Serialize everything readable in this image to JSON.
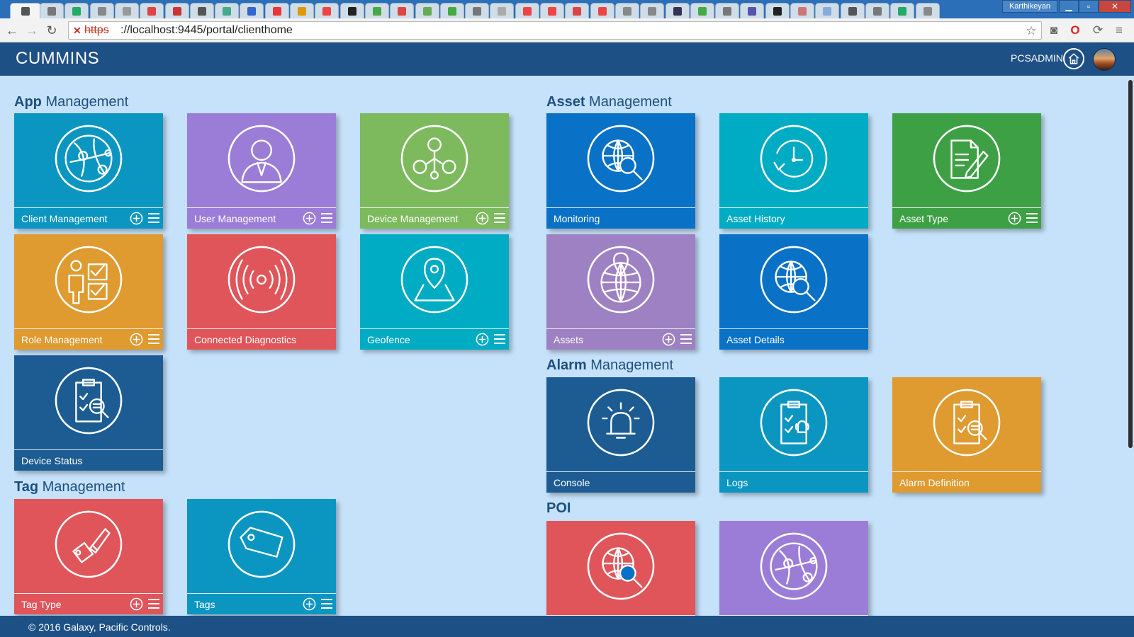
{
  "browser": {
    "profile_name": "Karthikeyan",
    "url_scheme": "https",
    "url_rest": "://localhost:9445/portal/clienthome",
    "tab_count": 37
  },
  "header": {
    "brand": "CUMMINS",
    "username": "PCSADMIN"
  },
  "sections": {
    "app": {
      "bold": "App",
      "rest": " Management"
    },
    "tag": {
      "bold": "Tag",
      "rest": " Management"
    },
    "asset": {
      "bold": "Asset",
      "rest": " Management"
    },
    "alarm": {
      "bold": "Alarm",
      "rest": " Management"
    },
    "poi": {
      "bold": "POI",
      "rest": ""
    }
  },
  "tiles": [
    {
      "label": "Client Management",
      "icon": "globe-network-icon",
      "color": "#0b96c2",
      "actions": true
    },
    {
      "label": "User Management",
      "icon": "user-icon",
      "color": "#9b7dd8",
      "actions": true
    },
    {
      "label": "Device Management",
      "icon": "device-network-icon",
      "color": "#7dba5e",
      "actions": true
    },
    {
      "label": "Role Management",
      "icon": "role-checklist-icon",
      "color": "#df9a30",
      "actions": true
    },
    {
      "label": "Connected Diagnostics",
      "icon": "signal-broadcast-icon",
      "color": "#e0555a",
      "actions": false
    },
    {
      "label": "Geofence",
      "icon": "map-pin-icon",
      "color": "#00acc3",
      "actions": true
    },
    {
      "label": "Device Status",
      "icon": "clipboard-search-icon",
      "color": "#1c5c93",
      "actions": false
    },
    {
      "label": "Tag Type",
      "icon": "tag-pencil-icon",
      "color": "#e0555a",
      "actions": true
    },
    {
      "label": "Tags",
      "icon": "tag-icon",
      "color": "#0b96c2",
      "actions": true
    },
    {
      "label": "Monitoring",
      "icon": "globe-search-icon",
      "color": "#0971c6",
      "actions": false
    },
    {
      "label": "Asset History",
      "icon": "history-clock-icon",
      "color": "#00acc3",
      "actions": false
    },
    {
      "label": "Asset Type",
      "icon": "document-edit-icon",
      "color": "#3ea044",
      "actions": true
    },
    {
      "label": "Assets",
      "icon": "globe-pin-icon",
      "color": "#9e81c2",
      "actions": true
    },
    {
      "label": "Asset Details",
      "icon": "globe-search-icon",
      "color": "#0971c6",
      "actions": false
    },
    {
      "label": "Console",
      "icon": "alarm-bell-icon",
      "color": "#1c5c93",
      "actions": false
    },
    {
      "label": "Logs",
      "icon": "clipboard-alarm-icon",
      "color": "#0b96c2",
      "actions": false
    },
    {
      "label": "Alarm Definition",
      "icon": "clipboard-search-icon",
      "color": "#df9a30",
      "actions": false
    },
    {
      "label": "",
      "icon": "globe-search-icon",
      "color": "#e0555a",
      "actions": false
    },
    {
      "label": "",
      "icon": "globe-network-icon",
      "color": "#9b7dd8",
      "actions": false
    }
  ],
  "footer": {
    "copyright": "© 2016 Galaxy, Pacific Controls."
  }
}
